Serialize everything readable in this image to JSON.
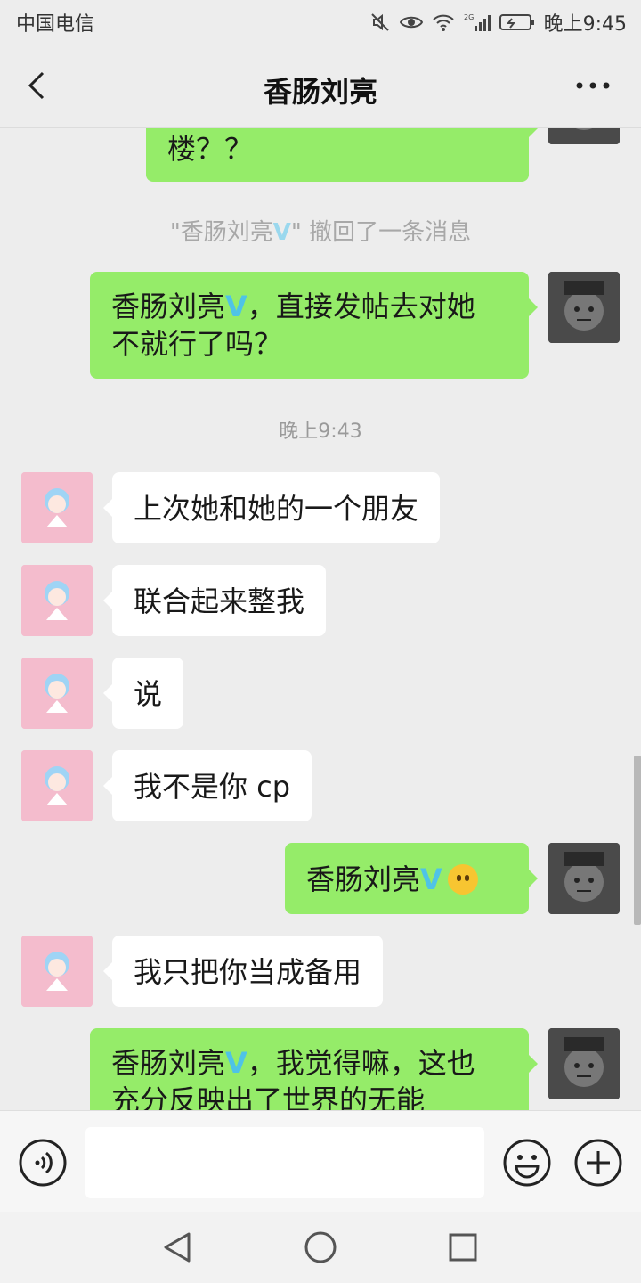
{
  "status_bar": {
    "carrier": "中国电信",
    "network": "2G",
    "time": "晚上9:45"
  },
  "header": {
    "title": "香肠刘亮",
    "back_icon": "chevron-left-icon",
    "more_icon": "more-dots-icon"
  },
  "messages": {
    "m0": {
      "text": "楼？？",
      "side": "out"
    },
    "recall": {
      "prefix": "\"香肠刘亮",
      "badge": "V",
      "suffix": "\" 撤回了一条消息"
    },
    "m1": {
      "name": "香肠刘亮",
      "badge": "V",
      "rest_line1": "，直接发帖去对她",
      "line2": "不就行了吗？",
      "side": "out"
    },
    "time1": "晚上9:43",
    "m2": {
      "text": "上次她和她的一个朋友",
      "side": "in"
    },
    "m3": {
      "text": "联合起来整我",
      "side": "in"
    },
    "m4": {
      "text": "说",
      "side": "in"
    },
    "m5": {
      "text": "我不是你 cp",
      "side": "in"
    },
    "m6": {
      "name": "香肠刘亮",
      "badge": "V",
      "emoji": "neutral-face-emoji",
      "side": "out"
    },
    "m7": {
      "text": "我只把你当成备用",
      "side": "in"
    },
    "m8": {
      "name": "香肠刘亮",
      "badge": "V",
      "rest_line1": "，我觉得嘛，这也",
      "line2": "充分反映出了世界的无能",
      "side": "out"
    }
  },
  "input_bar": {
    "voice_icon": "voice-icon",
    "emoji_icon": "emoji-icon",
    "plus_icon": "plus-icon",
    "text_value": ""
  },
  "system_nav": {
    "back_icon": "triangle-back-icon",
    "home_icon": "circle-home-icon",
    "recent_icon": "square-recent-icon"
  },
  "colors": {
    "background": "#ededed",
    "bubble_out": "#95ec69",
    "bubble_in": "#ffffff",
    "badge": "#4fc3e6",
    "avatar_in": "#f4bccd"
  }
}
